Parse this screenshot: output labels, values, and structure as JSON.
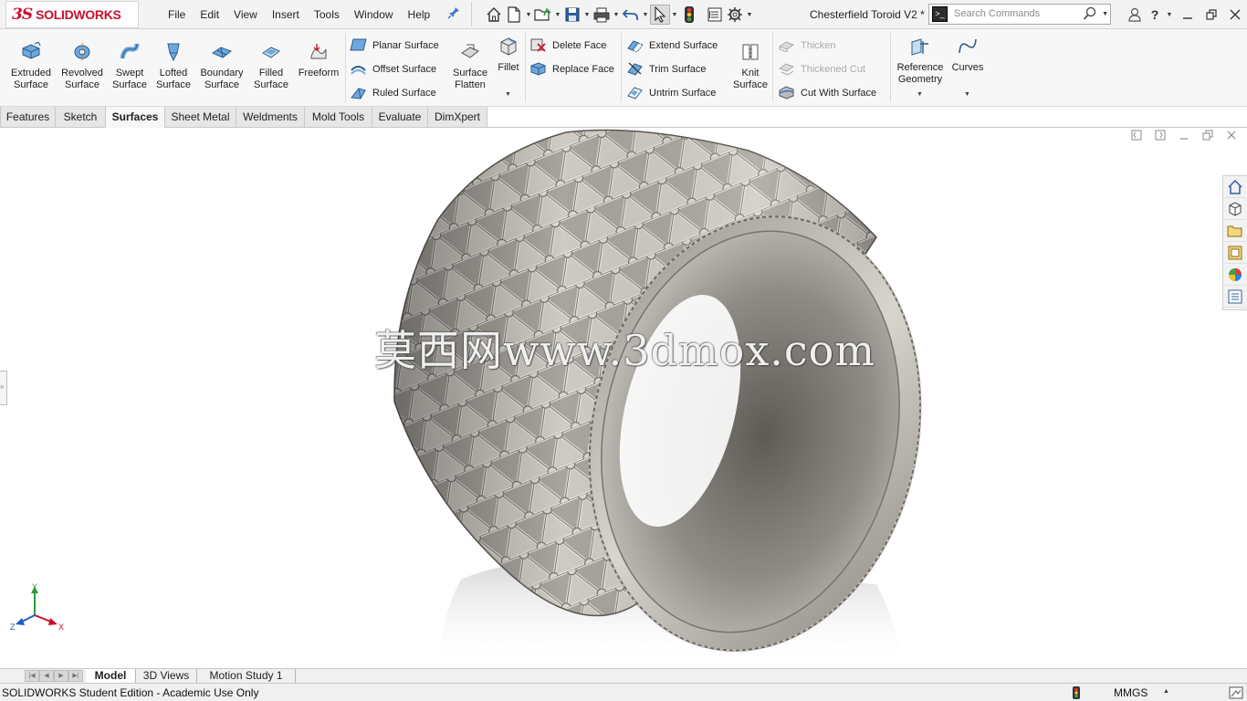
{
  "app": {
    "logo_mark": "3S",
    "logo_text": "SOLIDWORKS",
    "document_title": "Chesterfield Toroid V2 *",
    "brand_color": "#c8102e"
  },
  "menu": [
    "File",
    "Edit",
    "View",
    "Insert",
    "Tools",
    "Window",
    "Help"
  ],
  "search": {
    "placeholder": "Search Commands",
    "cmd_glyph": ">_"
  },
  "quick_access": [
    "home-icon",
    "new-document-icon",
    "open-icon",
    "save-icon",
    "print-icon",
    "undo-icon",
    "select-icon",
    "rebuild-icon",
    "file-properties-icon",
    "options-icon"
  ],
  "ribbon": {
    "extruded_surface": "Extruded\nSurface",
    "revolved_surface": "Revolved\nSurface",
    "swept_surface": "Swept\nSurface",
    "lofted_surface": "Lofted\nSurface",
    "boundary_surface": "Boundary\nSurface",
    "filled_surface": "Filled\nSurface",
    "freeform": "Freeform",
    "planar_surface": "Planar Surface",
    "offset_surface": "Offset Surface",
    "ruled_surface": "Ruled Surface",
    "surface_flatten": "Surface\nFlatten",
    "fillet": "Fillet",
    "delete_face": "Delete Face",
    "replace_face": "Replace Face",
    "extend_surface": "Extend Surface",
    "trim_surface": "Trim Surface",
    "untrim_surface": "Untrim Surface",
    "knit_surface": "Knit\nSurface",
    "thicken": "Thicken",
    "thickened_cut": "Thickened Cut",
    "cut_with_surface": "Cut With Surface",
    "reference_geometry": "Reference\nGeometry",
    "curves": "Curves"
  },
  "tabs": [
    {
      "label": "Features"
    },
    {
      "label": "Sketch"
    },
    {
      "label": "Surfaces",
      "active": true
    },
    {
      "label": "Sheet Metal"
    },
    {
      "label": "Weldments"
    },
    {
      "label": "Mold Tools"
    },
    {
      "label": "Evaluate"
    },
    {
      "label": "DimXpert"
    }
  ],
  "viewport": {
    "watermark": "莫西网www.3dmox.com",
    "triad_labels": {
      "x": "X",
      "y": "Y",
      "z": "Z"
    }
  },
  "task_pane": [
    "home-icon",
    "design-library-icon",
    "file-explorer-icon",
    "view-palette-icon",
    "appearances-icon",
    "custom-properties-icon"
  ],
  "bottom_tabs": [
    {
      "label": "Model",
      "active": true
    },
    {
      "label": "3D Views"
    },
    {
      "label": "Motion Study 1"
    }
  ],
  "status": {
    "edition": "SOLIDWORKS Student Edition - Academic Use Only",
    "units": "MMGS"
  }
}
